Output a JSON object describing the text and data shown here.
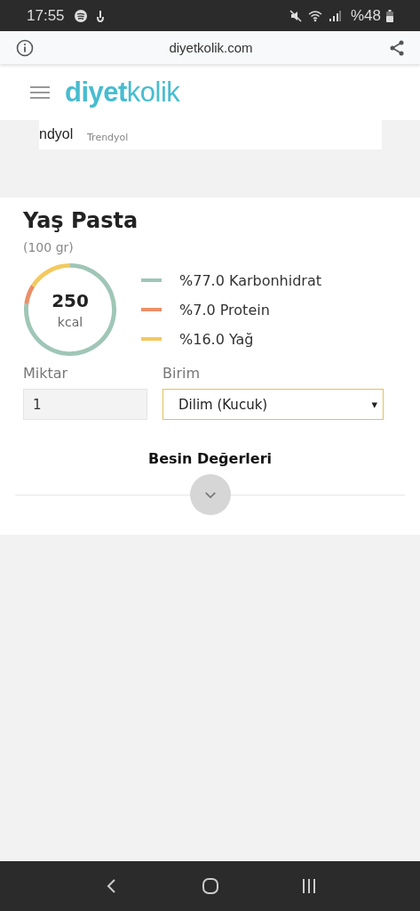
{
  "status_bar": {
    "time": "17:55",
    "battery": "%48"
  },
  "browser": {
    "url": "diyetkolik.com"
  },
  "header": {
    "logo_bold": "diyet",
    "logo_light": "kolik"
  },
  "ad": {
    "logo": "ndyol",
    "source": "Trendyol"
  },
  "food": {
    "title": "Yaş Pasta",
    "portion": "(100 gr)",
    "calories": "250",
    "calorie_unit": "kcal",
    "chart_data": {
      "type": "donut",
      "values": [
        77,
        7,
        16
      ]
    },
    "legend": [
      {
        "label": "%77.0 Karbonhidrat",
        "color": "#9fc6b7"
      },
      {
        "label": "%7.0 Protein",
        "color": "#ea9068"
      },
      {
        "label": "%16.0 Yağ",
        "color": "#f3c95e"
      }
    ],
    "amount": {
      "label": "Miktar",
      "value": "1"
    },
    "unit": {
      "label": "Birim",
      "value": "Dilim (Kucuk)",
      "caret": "▾"
    },
    "nutrition": {
      "title": "Besin Değerleri",
      "expanded": false
    }
  }
}
